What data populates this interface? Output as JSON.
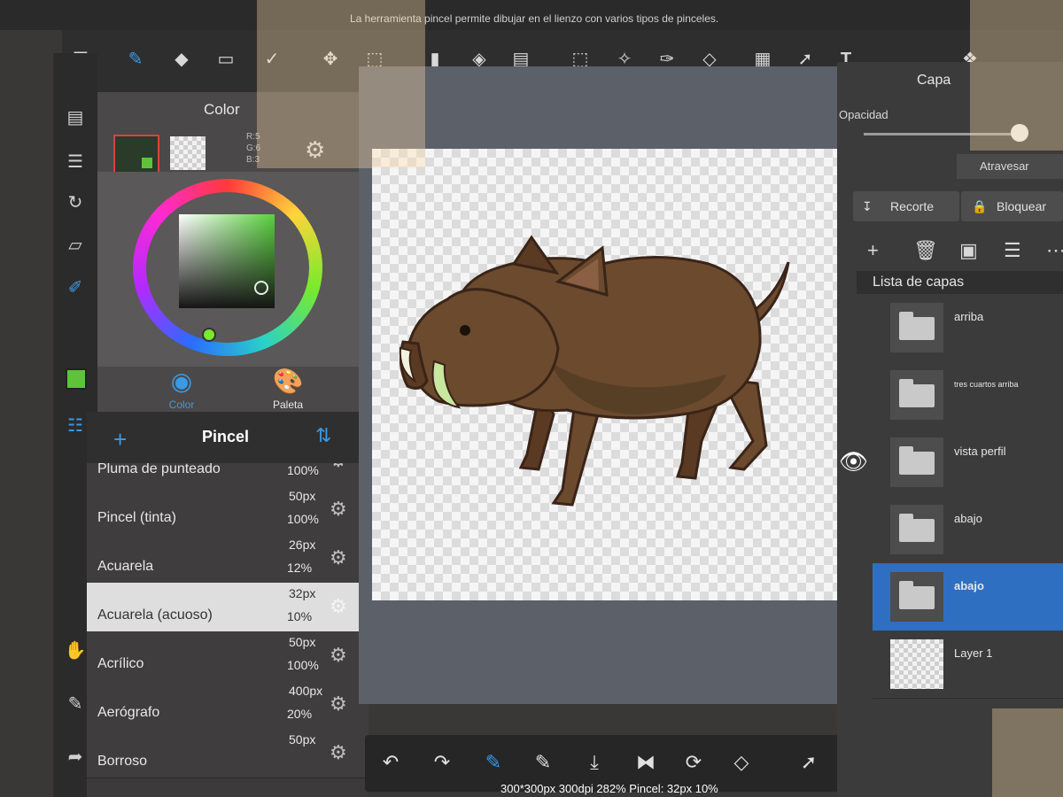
{
  "hint": "La herramienta pincel permite dibujar en el lienzo con varios tipos de pinceles.",
  "toolbar": {
    "tools": [
      "menu-icon",
      "brush-icon",
      "eraser-icon",
      "rectangle-icon",
      "check-icon",
      "move-icon",
      "transform-icon",
      "fill-icon",
      "bucket-icon",
      "gradient-icon",
      "selection-icon",
      "magic-wand-icon",
      "select-pen-icon",
      "select-eraser-icon",
      "layer-icon",
      "select-arrow-icon",
      "text-icon",
      "materials-icon"
    ]
  },
  "color_panel": {
    "title": "Color",
    "rgb": [
      "R:5",
      "G:6",
      "B:3"
    ],
    "tabs": {
      "color": "Color",
      "palette": "Paleta"
    }
  },
  "brush_panel": {
    "title": "Pincel",
    "brushes": [
      {
        "name": "Pluma de punteado",
        "size": "",
        "opacity": "100%"
      },
      {
        "name": "Pincel (tinta)",
        "size": "50px",
        "opacity": "100%"
      },
      {
        "name": "Acuarela",
        "size": "26px",
        "opacity": "12%"
      },
      {
        "name": "Acuarela (acuoso)",
        "size": "32px",
        "opacity": "10%",
        "selected": true
      },
      {
        "name": "Acrílico",
        "size": "50px",
        "opacity": "100%"
      },
      {
        "name": "Aerógrafo",
        "size": "400px",
        "opacity": "20%"
      },
      {
        "name": "Borroso",
        "size": "50px",
        "opacity": ""
      }
    ]
  },
  "status": "300*300px 300dpi 282% Pincel: 32px 10%",
  "layer_panel": {
    "title": "Capa",
    "opacity_label": "Opacidad",
    "opacity_value": 0.92,
    "blend_mode": "Atravesar",
    "clip_label": "Recorte",
    "lock_label": "Bloquear",
    "list_header": "Lista de capas",
    "layers": [
      {
        "name": "arriba",
        "type": "folder",
        "visible": false,
        "selected": false
      },
      {
        "name": "tres cuartos arriba",
        "type": "folder",
        "visible": false,
        "selected": false
      },
      {
        "name": "vista perfil",
        "type": "folder",
        "visible": true,
        "selected": false
      },
      {
        "name": "abajo",
        "type": "folder",
        "visible": false,
        "selected": false
      },
      {
        "name": "abajo",
        "type": "folder",
        "visible": false,
        "selected": true
      },
      {
        "name": "Layer 1",
        "type": "raster",
        "visible": false,
        "selected": false
      }
    ]
  },
  "colors": {
    "accent": "#3a9ae6",
    "selected_layer": "#2f6fc2",
    "foreground": "#2b3b2a",
    "boar_body": "#6b4a2e",
    "boar_outline": "#3a2418",
    "tusk": "#c8e8a0"
  }
}
